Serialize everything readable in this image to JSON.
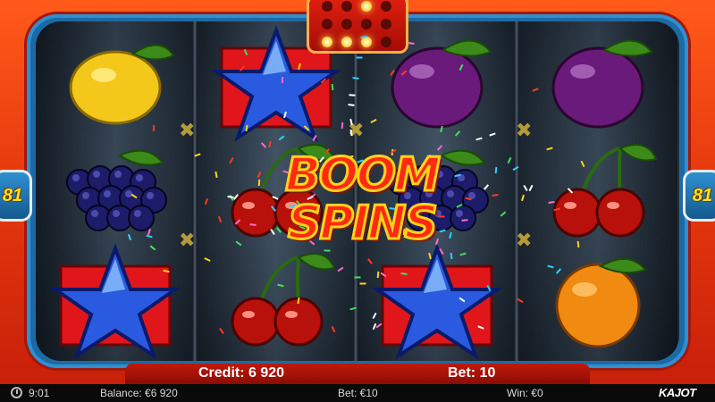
{
  "game": {
    "title_banner_line1": "BOOM",
    "title_banner_line2": "SPINS",
    "bet_lines_left": "81",
    "bet_lines_right": "81"
  },
  "reels": [
    [
      "lemon",
      "grapes",
      "star"
    ],
    [
      "star",
      "cherries",
      "cherries"
    ],
    [
      "plum",
      "grapes",
      "star"
    ],
    [
      "plum",
      "cherries",
      "orange"
    ]
  ],
  "bottom_panel": {
    "credit_label": "Credit: 6 920",
    "bet_label": "Bet: 10"
  },
  "status_bar": {
    "time": "9:01",
    "balance": "Balance: €6 920",
    "bet": "Bet: €10",
    "win": "Win: €0",
    "logo": "KAJOT"
  },
  "colors": {
    "cabinet": "#e83a0e",
    "frame": "#1c6aa5",
    "badge_text": "#ffe21a"
  }
}
